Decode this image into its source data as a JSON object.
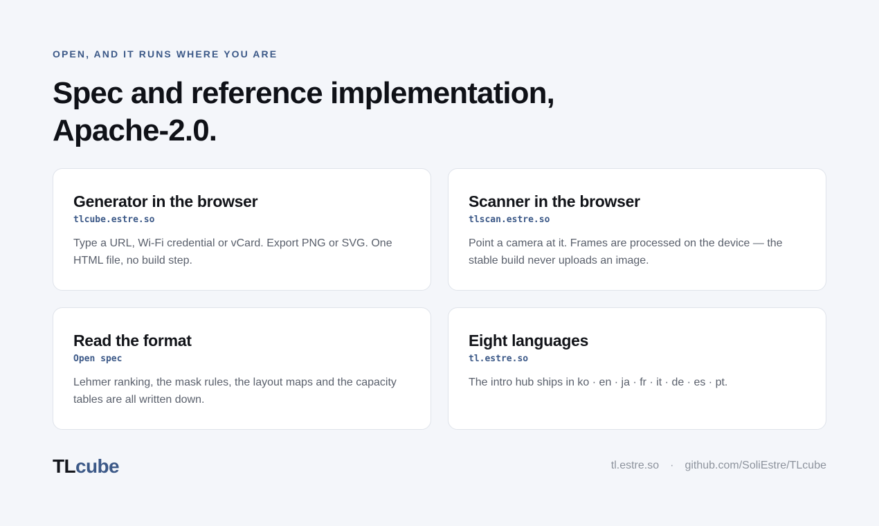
{
  "eyebrow": "OPEN, AND IT RUNS WHERE YOU ARE",
  "headline": {
    "line1": "Spec and reference implementation,",
    "line2": "Apache-2.0."
  },
  "cards": [
    {
      "title": "Generator in the browser",
      "link": "tlcube.estre.so",
      "description": "Type a URL, Wi-Fi credential or vCard. Export PNG or SVG. One HTML file, no build step."
    },
    {
      "title": "Scanner in the browser",
      "link": "tlscan.estre.so",
      "description": "Point a camera at it. Frames are processed on the device — the stable build never uploads an image."
    },
    {
      "title": "Read the format",
      "link": "Open spec",
      "description": "Lehmer ranking, the mask rules, the layout maps and the capacity tables are all written down."
    },
    {
      "title": "Eight languages",
      "link": "tl.estre.so",
      "description": "The intro hub ships in ko · en · ja · fr · it · de · es · pt."
    }
  ],
  "footer": {
    "logo_part1": "TL",
    "logo_part2": "cube",
    "link1": "tl.estre.so",
    "separator": "·",
    "link2": "github.com/SoliEstre/TLcube"
  },
  "colors": {
    "background": "#f4f6fa",
    "accent": "#3b5887",
    "text": "#14161c",
    "muted": "#5a606c",
    "card_border": "#dfe3ea"
  }
}
